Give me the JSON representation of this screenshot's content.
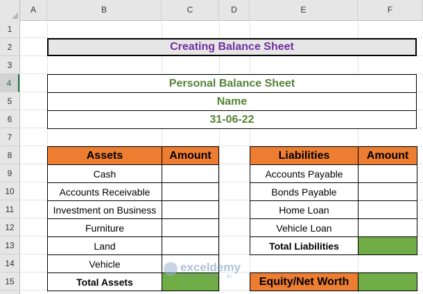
{
  "sheet": {
    "column_headers": [
      "A",
      "B",
      "C",
      "D",
      "E",
      "F"
    ],
    "row_headers": [
      "1",
      "2",
      "3",
      "4",
      "5",
      "6",
      "7",
      "8",
      "9",
      "10",
      "11",
      "12",
      "13",
      "14",
      "15"
    ],
    "title": "Creating Balance Sheet",
    "personal_header": {
      "heading": "Personal Balance Sheet",
      "name": "Name",
      "date": "31-06-22"
    },
    "assets": {
      "header_label": "Assets",
      "header_amount": "Amount",
      "items": [
        "Cash",
        "Accounts Receivable",
        "Investment on Business",
        "Furniture",
        "Land",
        "Vehicle"
      ],
      "total_label": "Total Assets"
    },
    "liabilities": {
      "header_label": "Liabilities",
      "header_amount": "Amount",
      "items": [
        "Accounts Payable",
        "Bonds Payable",
        "Home Loan",
        "Vehicle Loan"
      ],
      "total_label": "Total Liabilities"
    },
    "equity_label": "Equity/Net Worth",
    "colors": {
      "title_text": "#7030a0",
      "header_fill": "#ed7d31",
      "personal_text": "#548235",
      "total_fill": "#70ad47"
    }
  },
  "watermark": {
    "name": "exceldemy",
    "tagline": "EXCEL · DATA · BI"
  }
}
